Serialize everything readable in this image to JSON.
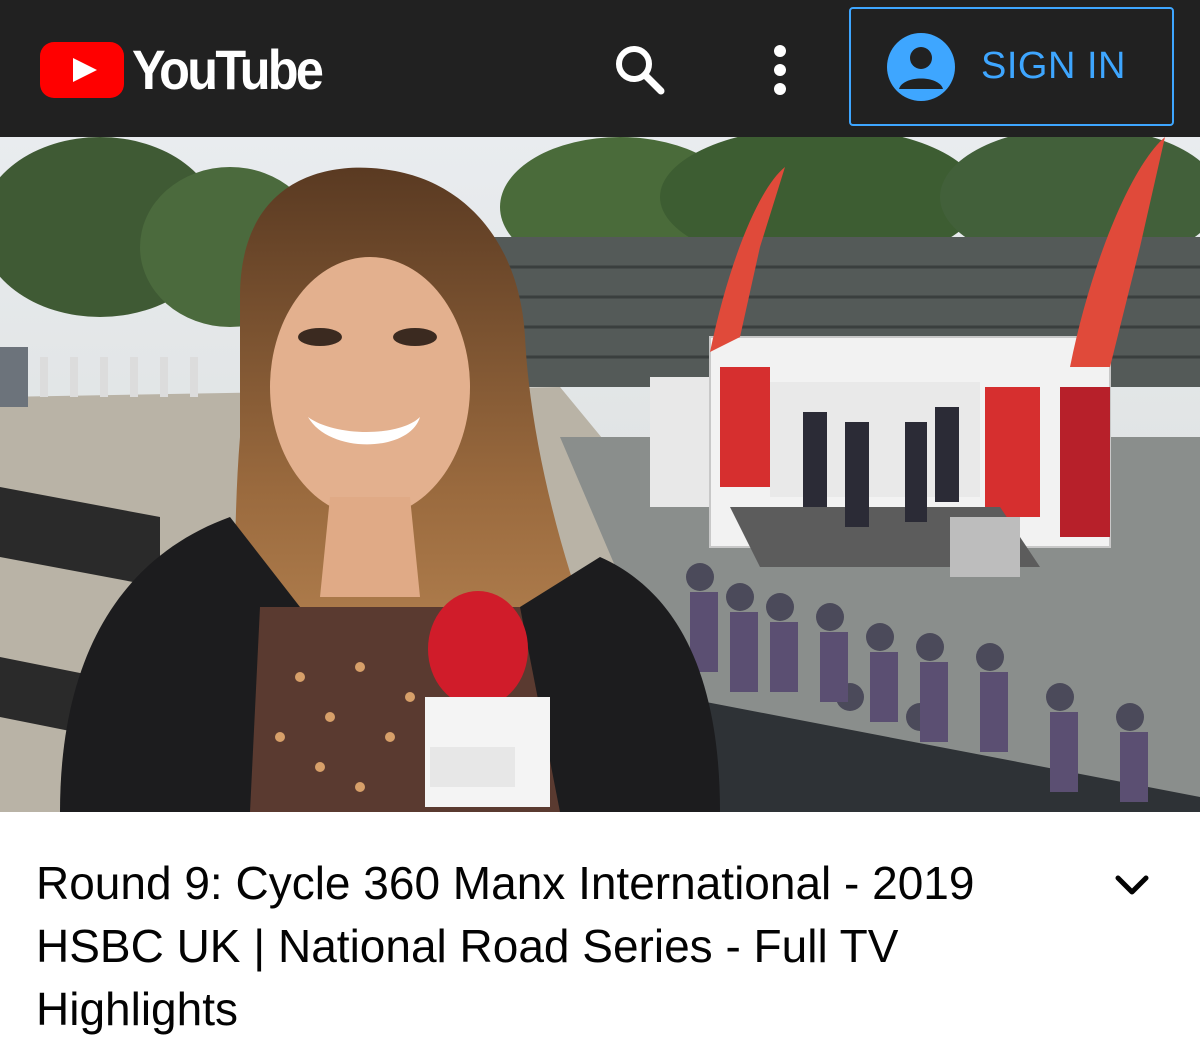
{
  "header": {
    "brand": "YouTube",
    "icons": [
      "youtube-logo-icon",
      "search-icon",
      "more-vert-icon",
      "account-circle-icon"
    ],
    "signin_label": "SIGN IN",
    "colors": {
      "bar": "#212121",
      "brand_red": "#ff0000",
      "accent": "#3ea6ff"
    }
  },
  "video": {
    "title": "Round 9: Cycle 360 Manx International - 2019 HSBC UK | National Road Series - Full TV Highlights",
    "expand_icon": "chevron-down-icon"
  }
}
